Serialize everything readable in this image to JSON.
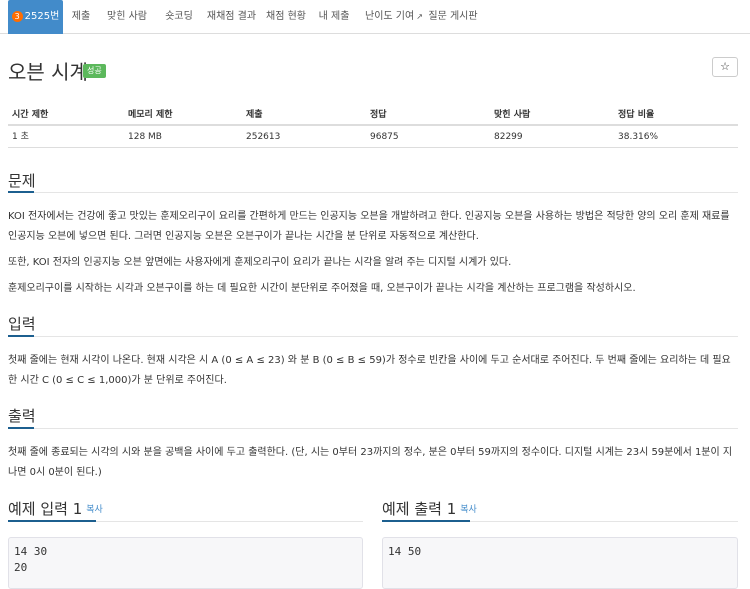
{
  "tabs": [
    {
      "badge": "3",
      "label": "2525번"
    },
    {
      "label": "제출"
    },
    {
      "label": "맞힌 사람"
    },
    {
      "label": "숏코딩"
    },
    {
      "label": "재채점 결과"
    },
    {
      "label": "채점 현황"
    },
    {
      "label": "내 제출"
    },
    {
      "label": "난이도 기여"
    },
    {
      "label": "질문 게시판"
    }
  ],
  "problem": {
    "title": "오븐 시계",
    "result_label": "성공",
    "star": "☆"
  },
  "info_table": {
    "headers": [
      "시간 제한",
      "메모리 제한",
      "제출",
      "정답",
      "맞힌 사람",
      "정답 비율"
    ],
    "row": [
      "1 초",
      "128 MB",
      "252613",
      "96875",
      "82299",
      "38.316%"
    ]
  },
  "sections": {
    "description": {
      "heading": "문제",
      "paragraphs": [
        "KOI 전자에서는 건강에 좋고 맛있는 훈제오리구이 요리를 간편하게 만드는 인공지능 오븐을 개발하려고 한다. 인공지능 오븐을 사용하는 방법은 적당한 양의 오리 훈제 재료를 인공지능 오븐에 넣으면 된다. 그러면 인공지능 오븐은 오븐구이가 끝나는 시간을 분 단위로 자동적으로 계산한다.",
        "또한, KOI 전자의 인공지능 오븐 앞면에는 사용자에게 훈제오리구이 요리가 끝나는 시각을 알려 주는 디지털 시계가 있다.",
        "훈제오리구이를 시작하는 시각과 오븐구이를 하는 데 필요한 시간이 분단위로 주어졌을 때, 오븐구이가 끝나는 시각을 계산하는 프로그램을 작성하시오."
      ]
    },
    "input": {
      "heading": "입력",
      "text": "첫째 줄에는 현재 시각이 나온다. 현재 시각은 시 A (0 ≤ A ≤ 23) 와 분 B (0 ≤ B ≤ 59)가 정수로 빈칸을 사이에 두고 순서대로 주어진다. 두 번째 줄에는 요리하는 데 필요한 시간 C (0 ≤ C ≤ 1,000)가 분 단위로 주어진다."
    },
    "output": {
      "heading": "출력",
      "text": "첫째 줄에 종료되는 시각의 시와 분을 공백을 사이에 두고 출력한다. (단, 시는 0부터 23까지의 정수, 분은 0부터 59까지의 정수이다. 디지털 시계는 23시 59분에서 1분이 지나면 0시 0분이 된다.)"
    }
  },
  "samples": {
    "input": {
      "heading": "예제 입력 1",
      "copy": "복사",
      "content": "14 30\n20"
    },
    "output": {
      "heading": "예제 출력 1",
      "copy": "복사",
      "content": "14 50"
    }
  }
}
